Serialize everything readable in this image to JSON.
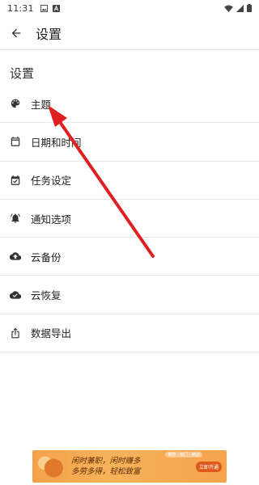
{
  "status_bar": {
    "time": "11:31"
  },
  "app_bar": {
    "title": "设置"
  },
  "section": {
    "title": "设置"
  },
  "items": [
    {
      "label": "主题",
      "icon": "palette-icon"
    },
    {
      "label": "日期和时间",
      "icon": "calendar-icon"
    },
    {
      "label": "任务设定",
      "icon": "calendar-check-icon"
    },
    {
      "label": "通知选项",
      "icon": "bell-icon"
    },
    {
      "label": "云备份",
      "icon": "cloud-upload-icon"
    },
    {
      "label": "云恢复",
      "icon": "cloud-done-icon"
    },
    {
      "label": "数据导出",
      "icon": "share-icon"
    }
  ],
  "annotation": {
    "color": "#e02020"
  },
  "ad": {
    "text_line1": "闲时兼职，闲时赚多",
    "text_line2": "多劳多得，轻松致富",
    "badge": "推荐 · 热门 · 精选",
    "cta": "立即开通"
  }
}
